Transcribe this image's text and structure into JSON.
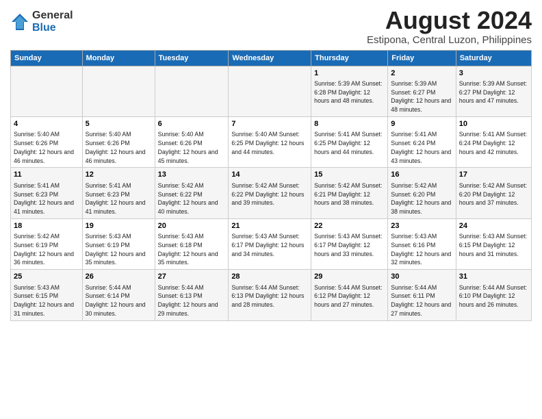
{
  "header": {
    "logo_general": "General",
    "logo_blue": "Blue",
    "title": "August 2024",
    "subtitle": "Estipona, Central Luzon, Philippines"
  },
  "weekdays": [
    "Sunday",
    "Monday",
    "Tuesday",
    "Wednesday",
    "Thursday",
    "Friday",
    "Saturday"
  ],
  "weeks": [
    [
      {
        "day": "",
        "info": ""
      },
      {
        "day": "",
        "info": ""
      },
      {
        "day": "",
        "info": ""
      },
      {
        "day": "",
        "info": ""
      },
      {
        "day": "1",
        "info": "Sunrise: 5:39 AM\nSunset: 6:28 PM\nDaylight: 12 hours\nand 48 minutes."
      },
      {
        "day": "2",
        "info": "Sunrise: 5:39 AM\nSunset: 6:27 PM\nDaylight: 12 hours\nand 48 minutes."
      },
      {
        "day": "3",
        "info": "Sunrise: 5:39 AM\nSunset: 6:27 PM\nDaylight: 12 hours\nand 47 minutes."
      }
    ],
    [
      {
        "day": "4",
        "info": "Sunrise: 5:40 AM\nSunset: 6:26 PM\nDaylight: 12 hours\nand 46 minutes."
      },
      {
        "day": "5",
        "info": "Sunrise: 5:40 AM\nSunset: 6:26 PM\nDaylight: 12 hours\nand 46 minutes."
      },
      {
        "day": "6",
        "info": "Sunrise: 5:40 AM\nSunset: 6:26 PM\nDaylight: 12 hours\nand 45 minutes."
      },
      {
        "day": "7",
        "info": "Sunrise: 5:40 AM\nSunset: 6:25 PM\nDaylight: 12 hours\nand 44 minutes."
      },
      {
        "day": "8",
        "info": "Sunrise: 5:41 AM\nSunset: 6:25 PM\nDaylight: 12 hours\nand 44 minutes."
      },
      {
        "day": "9",
        "info": "Sunrise: 5:41 AM\nSunset: 6:24 PM\nDaylight: 12 hours\nand 43 minutes."
      },
      {
        "day": "10",
        "info": "Sunrise: 5:41 AM\nSunset: 6:24 PM\nDaylight: 12 hours\nand 42 minutes."
      }
    ],
    [
      {
        "day": "11",
        "info": "Sunrise: 5:41 AM\nSunset: 6:23 PM\nDaylight: 12 hours\nand 41 minutes."
      },
      {
        "day": "12",
        "info": "Sunrise: 5:41 AM\nSunset: 6:23 PM\nDaylight: 12 hours\nand 41 minutes."
      },
      {
        "day": "13",
        "info": "Sunrise: 5:42 AM\nSunset: 6:22 PM\nDaylight: 12 hours\nand 40 minutes."
      },
      {
        "day": "14",
        "info": "Sunrise: 5:42 AM\nSunset: 6:22 PM\nDaylight: 12 hours\nand 39 minutes."
      },
      {
        "day": "15",
        "info": "Sunrise: 5:42 AM\nSunset: 6:21 PM\nDaylight: 12 hours\nand 38 minutes."
      },
      {
        "day": "16",
        "info": "Sunrise: 5:42 AM\nSunset: 6:20 PM\nDaylight: 12 hours\nand 38 minutes."
      },
      {
        "day": "17",
        "info": "Sunrise: 5:42 AM\nSunset: 6:20 PM\nDaylight: 12 hours\nand 37 minutes."
      }
    ],
    [
      {
        "day": "18",
        "info": "Sunrise: 5:42 AM\nSunset: 6:19 PM\nDaylight: 12 hours\nand 36 minutes."
      },
      {
        "day": "19",
        "info": "Sunrise: 5:43 AM\nSunset: 6:19 PM\nDaylight: 12 hours\nand 35 minutes."
      },
      {
        "day": "20",
        "info": "Sunrise: 5:43 AM\nSunset: 6:18 PM\nDaylight: 12 hours\nand 35 minutes."
      },
      {
        "day": "21",
        "info": "Sunrise: 5:43 AM\nSunset: 6:17 PM\nDaylight: 12 hours\nand 34 minutes."
      },
      {
        "day": "22",
        "info": "Sunrise: 5:43 AM\nSunset: 6:17 PM\nDaylight: 12 hours\nand 33 minutes."
      },
      {
        "day": "23",
        "info": "Sunrise: 5:43 AM\nSunset: 6:16 PM\nDaylight: 12 hours\nand 32 minutes."
      },
      {
        "day": "24",
        "info": "Sunrise: 5:43 AM\nSunset: 6:15 PM\nDaylight: 12 hours\nand 31 minutes."
      }
    ],
    [
      {
        "day": "25",
        "info": "Sunrise: 5:43 AM\nSunset: 6:15 PM\nDaylight: 12 hours\nand 31 minutes."
      },
      {
        "day": "26",
        "info": "Sunrise: 5:44 AM\nSunset: 6:14 PM\nDaylight: 12 hours\nand 30 minutes."
      },
      {
        "day": "27",
        "info": "Sunrise: 5:44 AM\nSunset: 6:13 PM\nDaylight: 12 hours\nand 29 minutes."
      },
      {
        "day": "28",
        "info": "Sunrise: 5:44 AM\nSunset: 6:13 PM\nDaylight: 12 hours\nand 28 minutes."
      },
      {
        "day": "29",
        "info": "Sunrise: 5:44 AM\nSunset: 6:12 PM\nDaylight: 12 hours\nand 27 minutes."
      },
      {
        "day": "30",
        "info": "Sunrise: 5:44 AM\nSunset: 6:11 PM\nDaylight: 12 hours\nand 27 minutes."
      },
      {
        "day": "31",
        "info": "Sunrise: 5:44 AM\nSunset: 6:10 PM\nDaylight: 12 hours\nand 26 minutes."
      }
    ]
  ]
}
